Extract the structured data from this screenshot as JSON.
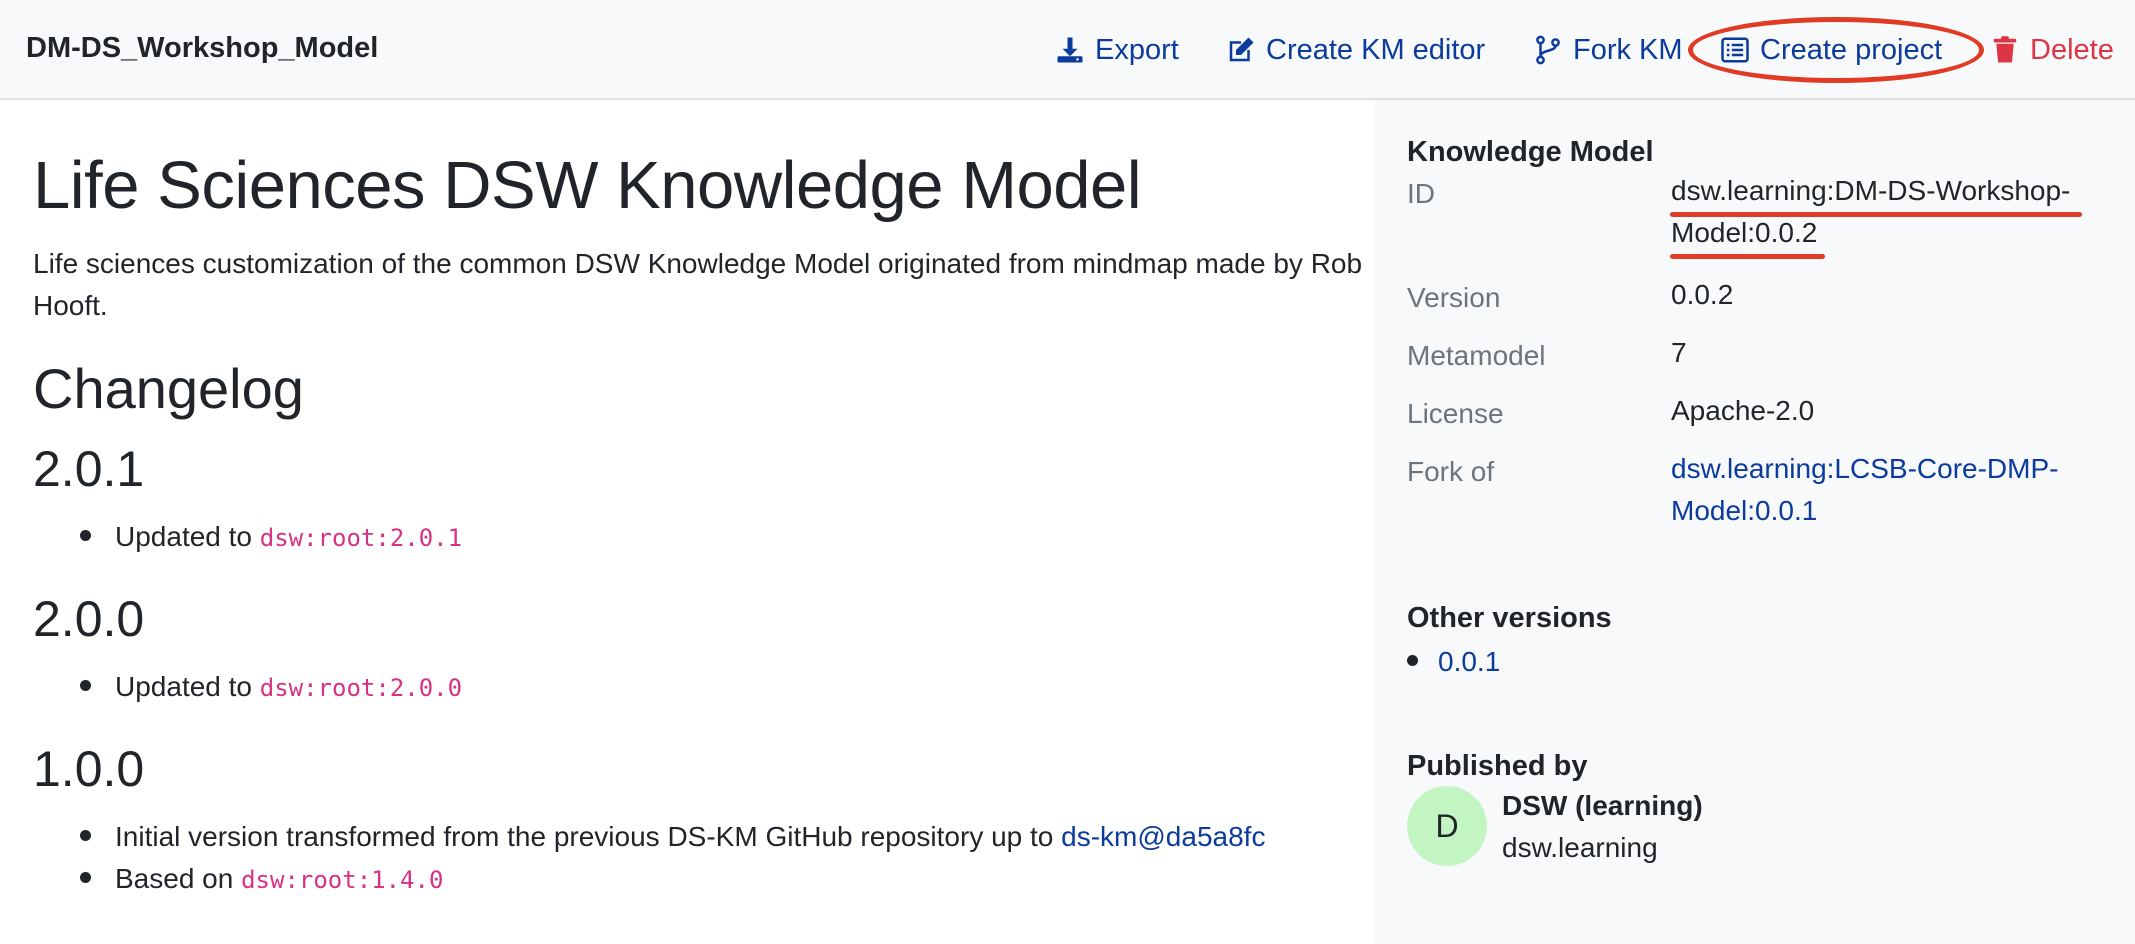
{
  "header": {
    "title": "DM-DS_Workshop_Model",
    "actions": {
      "export": "Export",
      "create_km_editor": "Create KM editor",
      "fork_km": "Fork KM",
      "create_project": "Create project",
      "delete": "Delete"
    }
  },
  "main": {
    "title": "Life Sciences DSW Knowledge Model",
    "description": "Life sciences customization of the common DSW Knowledge Model originated from mindmap made by Rob Hooft.",
    "changelog_heading": "Changelog",
    "versions": [
      {
        "version": "2.0.1",
        "items": [
          {
            "text": "Updated to ",
            "code": "dsw:root:2.0.1"
          }
        ]
      },
      {
        "version": "2.0.0",
        "items": [
          {
            "text": "Updated to ",
            "code": "dsw:root:2.0.0"
          }
        ]
      },
      {
        "version": "1.0.0",
        "items": [
          {
            "text": "Initial version transformed from the previous DS-KM GitHub repository up to ",
            "link": "ds-km@da5a8fc"
          },
          {
            "text": "Based on ",
            "code": "dsw:root:1.4.0"
          }
        ]
      }
    ]
  },
  "sidebar": {
    "km_heading": "Knowledge Model",
    "fields": {
      "id_label": "ID",
      "id_value": "dsw.learning:DM-DS-Workshop-Model:0.0.2",
      "version_label": "Version",
      "version_value": "0.0.2",
      "metamodel_label": "Metamodel",
      "metamodel_value": "7",
      "license_label": "License",
      "license_value": "Apache-2.0",
      "fork_of_label": "Fork of",
      "fork_of_value": "dsw.learning:LCSB-Core-DMP-Model:0.0.1"
    },
    "other_versions_heading": "Other versions",
    "other_versions": [
      "0.0.1"
    ],
    "published_by_heading": "Published by",
    "publisher": {
      "avatar_letter": "D",
      "name": "DSW (learning)",
      "id": "dsw.learning"
    }
  },
  "colors": {
    "link": "#0b3b9c",
    "delete": "#dc3545",
    "code": "#d63384",
    "annotation": "#e03b24",
    "avatar_bg": "#c3f5c3"
  },
  "icons": [
    "download-icon",
    "edit-icon",
    "fork-icon",
    "list-icon",
    "trash-icon"
  ]
}
